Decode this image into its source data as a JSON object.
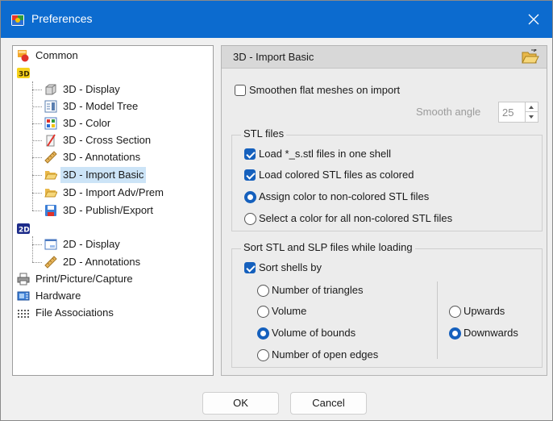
{
  "window": {
    "title": "Preferences"
  },
  "tree": {
    "items": [
      {
        "label": "Common",
        "icon": "common-settings-icon"
      },
      {
        "label": "3D",
        "icon": "3d-badge-icon"
      },
      {
        "label": "3D - Display",
        "icon": "cube-icon"
      },
      {
        "label": "3D - Model Tree",
        "icon": "model-tree-icon"
      },
      {
        "label": "3D - Color",
        "icon": "color-palette-icon"
      },
      {
        "label": "3D - Cross Section",
        "icon": "cross-section-icon"
      },
      {
        "label": "3D - Annotations",
        "icon": "ruler-icon"
      },
      {
        "label": "3D - Import Basic",
        "icon": "folder-open-icon",
        "selected": true
      },
      {
        "label": "3D - Import Adv/Prem",
        "icon": "folder-open-icon"
      },
      {
        "label": "3D - Publish/Export",
        "icon": "save-icon"
      },
      {
        "label": "2D",
        "icon": "2d-badge-icon"
      },
      {
        "label": "2D - Display",
        "icon": "window-icon"
      },
      {
        "label": "2D - Annotations",
        "icon": "ruler-icon"
      },
      {
        "label": "Print/Picture/Capture",
        "icon": "printer-icon"
      },
      {
        "label": "Hardware",
        "icon": "hardware-icon"
      },
      {
        "label": "File Associations",
        "icon": "file-associations-icon"
      }
    ]
  },
  "panel": {
    "title": "3D - Import Basic",
    "smoothen_label": "Smoothen flat meshes on import",
    "smoothen_checked": false,
    "smooth_angle_label": "Smooth angle",
    "smooth_angle_value": "25",
    "stl_group": {
      "legend": "STL files",
      "load_one_shell": "Load *_s.stl files in one shell",
      "load_colored": "Load colored STL files as colored",
      "assign_color": "Assign color to non-colored STL files",
      "select_color": "Select a color for all non-colored STL files",
      "selected_option": "assign_color"
    },
    "sort_group": {
      "legend": "Sort  STL and SLP files while loading",
      "sort_shells": "Sort shells by",
      "by_options": [
        "Number of triangles",
        "Volume",
        "Volume of bounds",
        "Number of open edges"
      ],
      "by_selected": "Volume of bounds",
      "direction_options": [
        "Upwards",
        "Downwards"
      ],
      "direction_selected": "Downwards"
    }
  },
  "buttons": {
    "ok": "OK",
    "cancel": "Cancel"
  },
  "colors": {
    "titlebar": "#0c6bcf",
    "accent": "#1560bd",
    "selection": "#cce4f7"
  }
}
